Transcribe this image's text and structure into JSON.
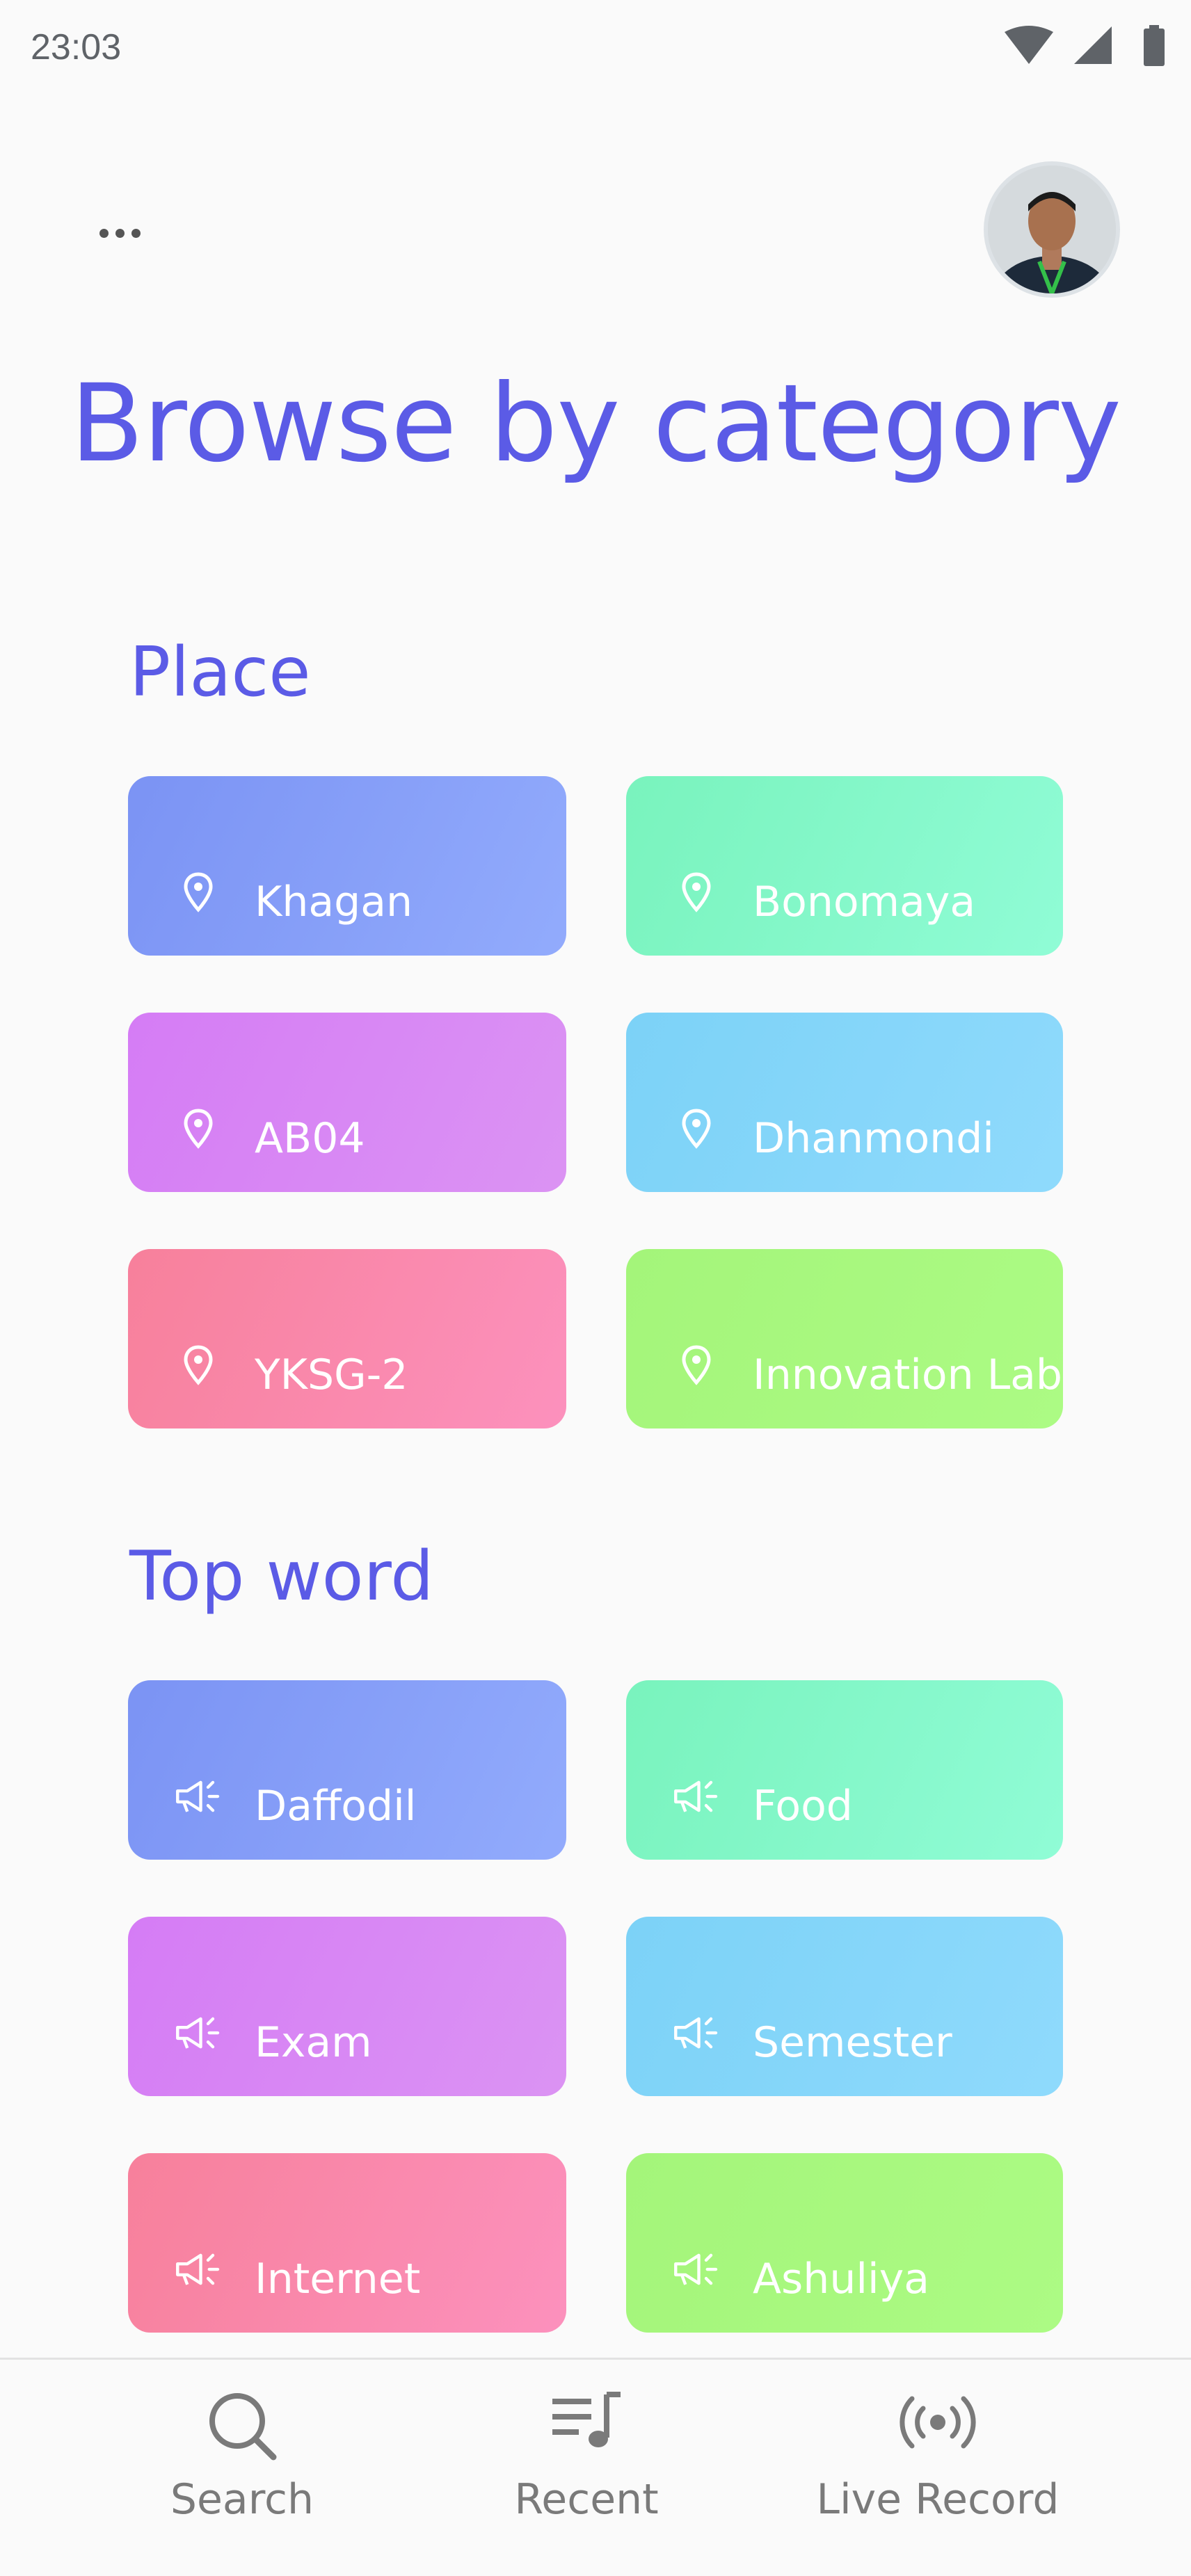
{
  "status_bar": {
    "time": "23:03"
  },
  "header": {
    "title": "Browse by category"
  },
  "sections": {
    "place": {
      "title": "Place",
      "items": [
        "Khagan",
        "Bonomaya",
        "AB04",
        "Dhanmondi",
        "YKSG-2",
        "Innovation Lab"
      ]
    },
    "top_word": {
      "title": "Top word",
      "items": [
        "Daffodil",
        "Food",
        "Exam",
        "Semester",
        "Internet",
        "Ashuliya"
      ]
    }
  },
  "bottom_nav": {
    "search": "Search",
    "recent": "Recent",
    "live_record": "Live Record"
  },
  "colors": {
    "accent": "#5b5be6",
    "tile_gradients": [
      "#7b93f4",
      "#79f3bd",
      "#d57cf5",
      "#7cd2f7",
      "#f7809b",
      "#a4f57a"
    ]
  },
  "icons": {
    "place_tile": "map-pin-icon",
    "word_tile": "megaphone-icon",
    "nav": [
      "search-icon",
      "playlist-icon",
      "broadcast-icon"
    ]
  }
}
